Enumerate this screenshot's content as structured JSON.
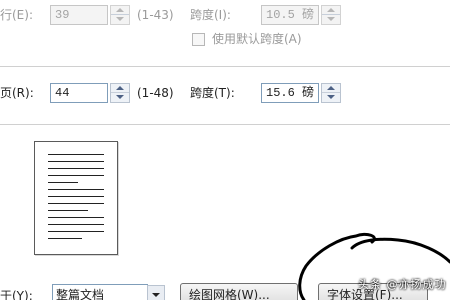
{
  "chars": {
    "label": "行(E):",
    "value": "39",
    "range": "(1-43)",
    "spacing_label": "跨度(I):",
    "spacing_value": "10.5 磅"
  },
  "default_spacing_checkbox": {
    "label": "使用默认跨度(A)",
    "checked": false
  },
  "lines": {
    "label": "页(R):",
    "value": "44",
    "range": "(1-48)",
    "spacing_label": "跨度(T):",
    "spacing_value": "15.6 磅"
  },
  "apply": {
    "label": "于(Y):",
    "value": "整篇文档"
  },
  "buttons": {
    "grid": "绘图网格(W)...",
    "font": "字体设置(F)..."
  },
  "watermark": "头条 @亦扬成功",
  "colors": {
    "scribble": "#000000",
    "field_border": "#7f9db9"
  }
}
